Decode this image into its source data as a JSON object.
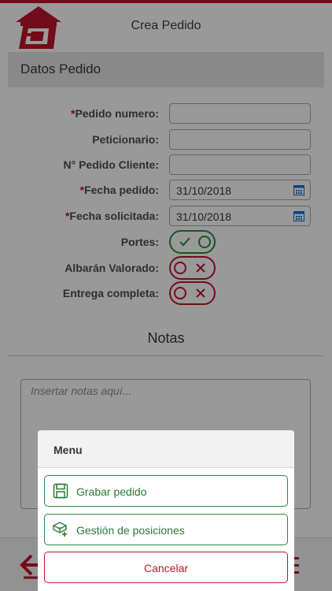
{
  "header": {
    "title": "Crea Pedido",
    "logo_icon": "home-logo-icon"
  },
  "section": {
    "title": "Datos Pedido"
  },
  "form": {
    "required_mark": "*",
    "fields": [
      {
        "label": "Pedido numero:",
        "required": true,
        "value": ""
      },
      {
        "label": "Peticionario:",
        "required": false,
        "value": ""
      },
      {
        "label": "N° Pedido Cliente:",
        "required": false,
        "value": ""
      },
      {
        "label": "Fecha pedido:",
        "required": true,
        "value": "31/10/2018",
        "icon": "calendar-icon"
      },
      {
        "label": "Fecha solicitada:",
        "required": true,
        "value": "31/10/2018",
        "icon": "calendar-icon"
      }
    ],
    "toggles": [
      {
        "label": "Portes:",
        "state": "on"
      },
      {
        "label": "Albarán Valorado:",
        "state": "off"
      },
      {
        "label": "Entrega completa:",
        "state": "off"
      }
    ]
  },
  "notes": {
    "title": "Notas",
    "placeholder": "Insertar notas aquí..."
  },
  "footer": {
    "back_icon": "arrow-left-icon"
  },
  "menu": {
    "title": "Menu",
    "items": [
      {
        "label": "Grabar pedido",
        "icon": "save-icon"
      },
      {
        "label": "Gestión de posiciones",
        "icon": "cube-add-icon"
      },
      {
        "label": "Cancelar"
      }
    ]
  },
  "colors": {
    "brand_red": "#c0142a",
    "accept_green": "#2a8a3a"
  }
}
